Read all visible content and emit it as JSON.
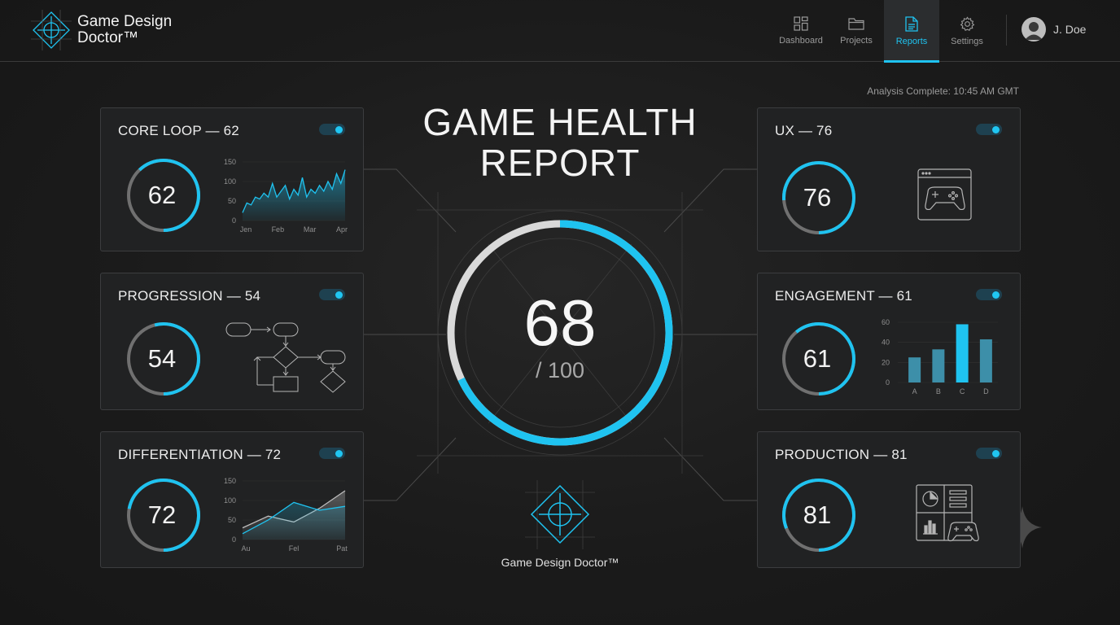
{
  "header": {
    "brand_name": "Game Design Doctor™",
    "nav": [
      {
        "label": "Dashboard",
        "icon": "grid-icon",
        "active": false
      },
      {
        "label": "Projects",
        "icon": "folder-icon",
        "active": false
      },
      {
        "label": "Reports",
        "icon": "document-icon",
        "active": true
      },
      {
        "label": "Settings",
        "icon": "gear-icon",
        "active": false
      }
    ],
    "user_name": "J. Doe"
  },
  "analysis_status": "Analysis Complete: 10:45 AM GMT",
  "title_line1": "GAME HEALTH",
  "title_line2": "REPORT",
  "overall": {
    "score": "68",
    "out_of": "/ 100",
    "fraction": 0.68
  },
  "footer_brand": "Game Design Doctor™",
  "colors": {
    "accent": "#1fc3f0",
    "track": "#707070",
    "card_bg": "#212223"
  },
  "cards": {
    "core_loop": {
      "title": "CORE LOOP — 62",
      "score": "62",
      "toggle_on": true
    },
    "progression": {
      "title": "PROGRESSION — 54",
      "score": "54",
      "toggle_on": true
    },
    "differentiation": {
      "title": "DIFFERENTIATION — 72",
      "score": "72",
      "toggle_on": true
    },
    "ux": {
      "title": "UX — 76",
      "score": "76",
      "toggle_on": true,
      "icon": "gamepad-window-icon"
    },
    "engagement": {
      "title": "ENGAGEMENT — 61",
      "score": "61",
      "toggle_on": true
    },
    "production": {
      "title": "PRODUCTION — 81",
      "score": "81",
      "toggle_on": true,
      "icon": "dashboard-gamepad-icon"
    }
  },
  "chart_data": [
    {
      "type": "area",
      "x": [
        "Jen",
        "Feb",
        "Mar",
        "Apr"
      ],
      "y_ticks": [
        "150",
        "100",
        "50",
        "0"
      ],
      "ylim": [
        0,
        150
      ],
      "series": [
        {
          "values": [
            20,
            45,
            40,
            60,
            55,
            70,
            60,
            95,
            60,
            75,
            90,
            55,
            80,
            65,
            110,
            60,
            80,
            70,
            90,
            75,
            100,
            80,
            120,
            95,
            130
          ]
        }
      ]
    },
    {
      "type": "bar",
      "categories": [
        "A",
        "B",
        "C",
        "D"
      ],
      "y_ticks": [
        "60",
        "40",
        "20",
        "0"
      ],
      "ylim": [
        0,
        60
      ],
      "series": [
        {
          "values": [
            25,
            33,
            58,
            43
          ]
        }
      ]
    },
    {
      "type": "area",
      "x": [
        "Au",
        "Fel",
        "Pat"
      ],
      "y_ticks": [
        "150",
        "100",
        "50",
        "0"
      ],
      "ylim": [
        0,
        150
      ],
      "series": [
        {
          "values": [
            30,
            60,
            45,
            80,
            125
          ]
        },
        {
          "values": [
            15,
            50,
            95,
            75,
            85
          ]
        }
      ]
    }
  ]
}
